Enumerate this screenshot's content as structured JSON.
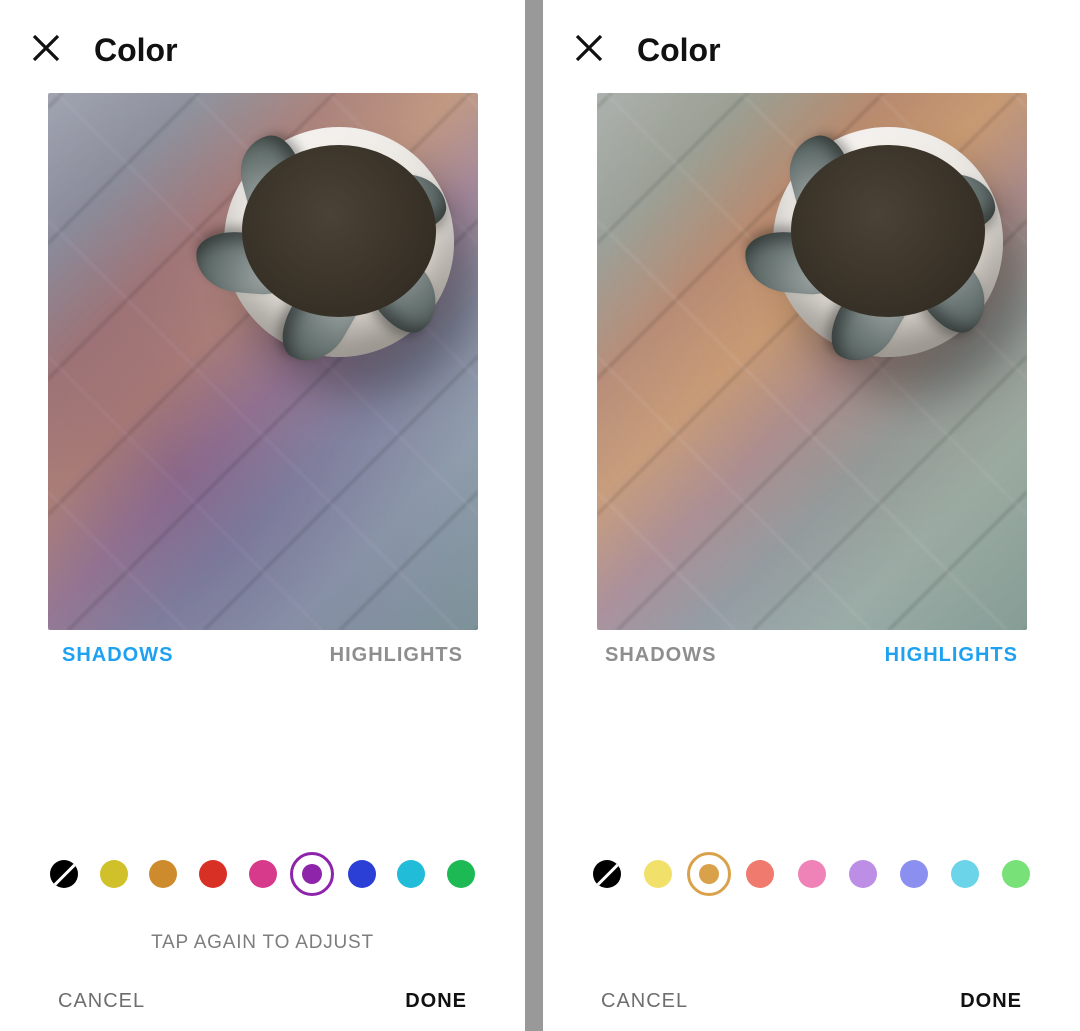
{
  "panels": [
    {
      "title": "Color",
      "active_tab": "shadows",
      "tabs": {
        "shadows": "SHADOWS",
        "highlights": "HIGHLIGHTS"
      },
      "hint": "TAP AGAIN TO ADJUST",
      "footer": {
        "cancel": "CANCEL",
        "done": "DONE"
      },
      "selected_swatch": "purple",
      "swatches": [
        {
          "id": "none",
          "name": "none-swatch",
          "hex": "#000000"
        },
        {
          "id": "yellow",
          "name": "yellow-swatch",
          "hex": "#d0c02a"
        },
        {
          "id": "orange",
          "name": "orange-swatch",
          "hex": "#cd8b2d"
        },
        {
          "id": "red",
          "name": "red-swatch",
          "hex": "#d93025"
        },
        {
          "id": "pink",
          "name": "pink-swatch",
          "hex": "#d83a8b"
        },
        {
          "id": "purple",
          "name": "purple-swatch",
          "hex": "#8e24aa"
        },
        {
          "id": "blue",
          "name": "blue-swatch",
          "hex": "#2b3fd6"
        },
        {
          "id": "cyan",
          "name": "cyan-swatch",
          "hex": "#20bcd8"
        },
        {
          "id": "green",
          "name": "green-swatch",
          "hex": "#1db954"
        }
      ]
    },
    {
      "title": "Color",
      "active_tab": "highlights",
      "tabs": {
        "shadows": "SHADOWS",
        "highlights": "HIGHLIGHTS"
      },
      "hint": "",
      "footer": {
        "cancel": "CANCEL",
        "done": "DONE"
      },
      "selected_swatch": "orange",
      "swatches": [
        {
          "id": "none",
          "name": "none-swatch",
          "hex": "#000000"
        },
        {
          "id": "yellow",
          "name": "yellow-swatch",
          "hex": "#f1e06a"
        },
        {
          "id": "orange",
          "name": "orange-swatch",
          "hex": "#d9a24a"
        },
        {
          "id": "red",
          "name": "red-swatch",
          "hex": "#ef7a6d"
        },
        {
          "id": "pink",
          "name": "pink-swatch",
          "hex": "#ef83b8"
        },
        {
          "id": "purple",
          "name": "purple-swatch",
          "hex": "#bd8ee6"
        },
        {
          "id": "blue",
          "name": "blue-swatch",
          "hex": "#8b8ff0"
        },
        {
          "id": "cyan",
          "name": "cyan-swatch",
          "hex": "#6bd4e8"
        },
        {
          "id": "green",
          "name": "green-swatch",
          "hex": "#78e278"
        }
      ]
    }
  ]
}
